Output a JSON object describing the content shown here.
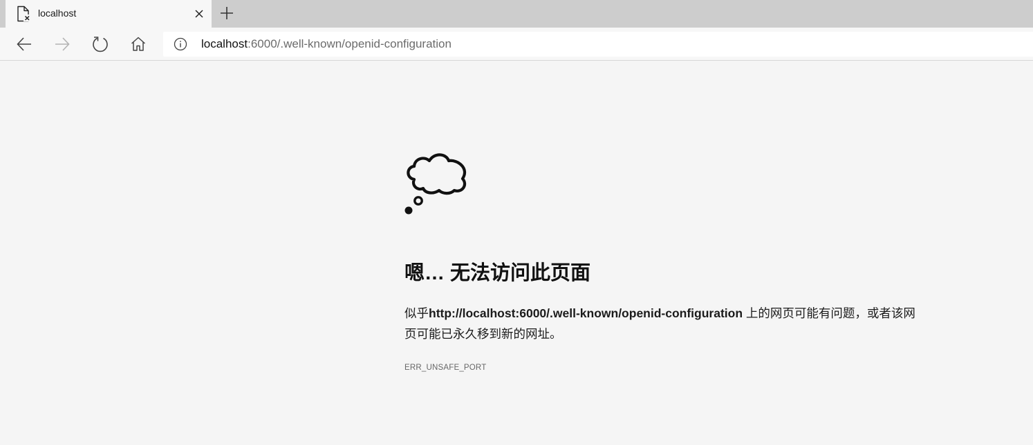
{
  "tab": {
    "title": "localhost",
    "icon": "broken-page-icon",
    "close_icon": "close-icon"
  },
  "new_tab_icon": "plus-icon",
  "toolbar": {
    "back_icon": "back-arrow-icon",
    "forward_icon": "forward-arrow-icon",
    "refresh_icon": "refresh-icon",
    "home_icon": "home-icon"
  },
  "address": {
    "info_icon": "info-icon",
    "host": "localhost",
    "path": ":6000/.well-known/openid-configuration"
  },
  "error": {
    "illustration": "thought-cloud-icon",
    "heading": "嗯… 无法访问此页面",
    "desc_prefix": "似乎",
    "desc_url": "http://localhost:6000/.well-known/openid-configuration",
    "desc_suffix": " 上的网页可能有问题，或者该网页可能已永久移到新的网址。",
    "code": "ERR_UNSAFE_PORT"
  },
  "colors": {
    "page_background": "#f5f5f5",
    "tabstrip_background": "#cdcdcd",
    "address_background": "#ffffff"
  }
}
